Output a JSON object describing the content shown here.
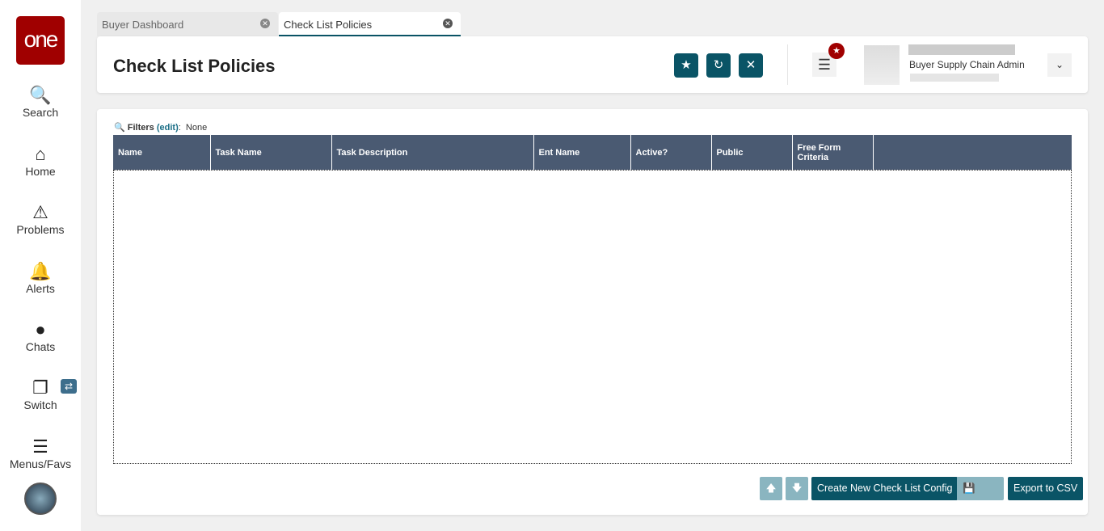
{
  "logo": "one",
  "nav": [
    {
      "label": "Search",
      "icon": "search-icon"
    },
    {
      "label": "Home",
      "icon": "home-icon"
    },
    {
      "label": "Problems",
      "icon": "warning-icon"
    },
    {
      "label": "Alerts",
      "icon": "bell-icon"
    },
    {
      "label": "Chats",
      "icon": "chat-icon"
    },
    {
      "label": "Switch",
      "icon": "switch-icon"
    },
    {
      "label": "Menus/Favs",
      "icon": "menu-icon"
    }
  ],
  "tabs": [
    {
      "label": "Buyer Dashboard"
    },
    {
      "label": "Check List Policies"
    }
  ],
  "header": {
    "title": "Check List Policies",
    "user_role": "Buyer Supply Chain Admin"
  },
  "filters": {
    "label": "Filters",
    "edit": "(edit)",
    "value": "None"
  },
  "table": {
    "columns": [
      "Name",
      "Task Name",
      "Task Description",
      "Ent Name",
      "Active?",
      "Public",
      "Free Form Criteria"
    ]
  },
  "buttons": {
    "create": "Create New Check List Config",
    "save": "Save",
    "export": "Export to CSV"
  }
}
